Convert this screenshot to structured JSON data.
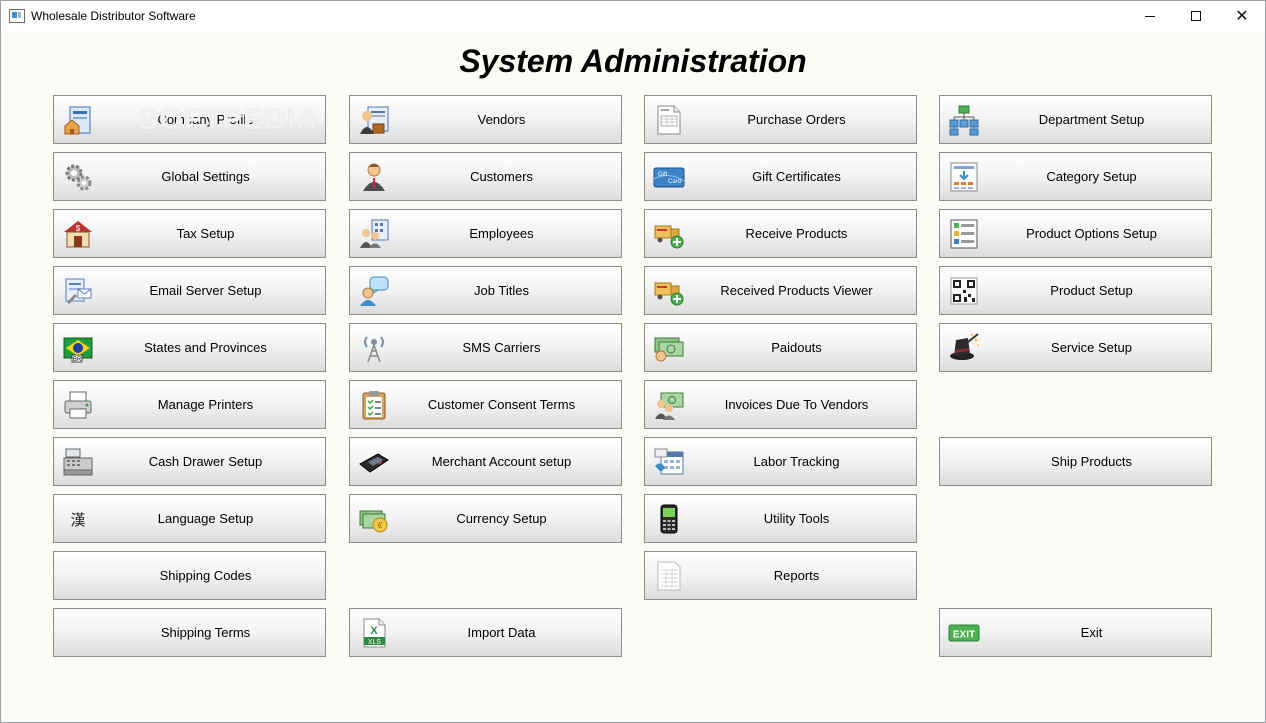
{
  "window": {
    "title": "Wholesale Distributor Software"
  },
  "page": {
    "title": "System Administration"
  },
  "watermark": "SOFTPEDIA",
  "columns": [
    [
      {
        "label": "Company Profile",
        "icon": "company-profile-icon"
      },
      {
        "label": "Global Settings",
        "icon": "gears-icon"
      },
      {
        "label": "Tax Setup",
        "icon": "tax-house-icon"
      },
      {
        "label": "Email Server Setup",
        "icon": "email-server-icon"
      },
      {
        "label": "States and Provinces",
        "icon": "brazil-flag-icon"
      },
      {
        "label": "Manage Printers",
        "icon": "printer-icon"
      },
      {
        "label": "Cash Drawer Setup",
        "icon": "cash-register-icon"
      },
      {
        "label": "Language Setup",
        "icon": "kanji-icon",
        "glyph": "漢"
      },
      {
        "label": "Shipping Codes",
        "icon": ""
      },
      {
        "label": "Shipping Terms",
        "icon": ""
      }
    ],
    [
      {
        "label": "Vendors",
        "icon": "vendors-icon"
      },
      {
        "label": "Customers",
        "icon": "customer-icon"
      },
      {
        "label": "Employees",
        "icon": "employees-icon"
      },
      {
        "label": "Job Titles",
        "icon": "job-titles-icon"
      },
      {
        "label": "SMS Carriers",
        "icon": "antenna-icon"
      },
      {
        "label": "Customer Consent Terms",
        "icon": "clipboard-icon"
      },
      {
        "label": "Merchant Account setup",
        "icon": "card-terminal-icon"
      },
      {
        "label": "Currency Setup",
        "icon": "currency-icon"
      },
      null,
      {
        "label": "Import Data",
        "icon": "xls-icon",
        "glyph": "XLS"
      }
    ],
    [
      {
        "label": "Purchase Orders",
        "icon": "document-icon"
      },
      {
        "label": "Gift Certificates",
        "icon": "gift-card-icon",
        "glyph": "Gift Card"
      },
      {
        "label": "Receive Products",
        "icon": "truck-add-icon"
      },
      {
        "label": "Received Products Viewer",
        "icon": "truck-add-icon"
      },
      {
        "label": "Paidouts",
        "icon": "money-icon"
      },
      {
        "label": "Invoices Due To Vendors",
        "icon": "money-people-icon"
      },
      {
        "label": "Labor Tracking",
        "icon": "calendar-icon"
      },
      {
        "label": "Utility Tools",
        "icon": "phone-icon"
      },
      {
        "label": "Reports",
        "icon": "spreadsheet-icon"
      },
      null
    ],
    [
      {
        "label": "Department Setup",
        "icon": "hierarchy-icon"
      },
      {
        "label": "Category Setup",
        "icon": "category-icon"
      },
      {
        "label": "Product Options Setup",
        "icon": "options-list-icon"
      },
      {
        "label": "Product Setup",
        "icon": "qr-code-icon"
      },
      {
        "label": "Service Setup",
        "icon": "magic-hat-icon"
      },
      null,
      {
        "label": "Ship Products",
        "icon": ""
      },
      null,
      null,
      {
        "label": "Exit",
        "icon": "exit-icon",
        "glyph": "EXIT"
      }
    ]
  ]
}
